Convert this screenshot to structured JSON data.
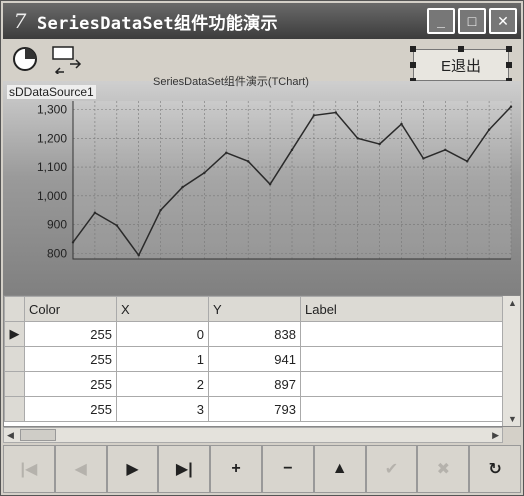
{
  "window": {
    "title": "SeriesDataSet组件功能演示",
    "icon": "seven-glyph"
  },
  "toolbar": {
    "exit_label": "E退出"
  },
  "chart_panel": {
    "datasource_label": "sDDataSource1",
    "title": "SeriesDataSet组件演示(TChart)",
    "axis_labels": [
      "1,300",
      "1,200",
      "1,100",
      "1,000",
      "900",
      "800"
    ]
  },
  "chart_data": {
    "type": "line",
    "title": "SeriesDataSet组件演示(TChart)",
    "xlabel": "",
    "ylabel": "",
    "ylim": [
      780,
      1330
    ],
    "x": [
      0,
      1,
      2,
      3,
      4,
      5,
      6,
      7,
      8,
      9,
      10,
      11,
      12,
      13,
      14,
      15,
      16,
      17,
      18,
      19,
      20
    ],
    "values": [
      838,
      941,
      897,
      793,
      950,
      1030,
      1080,
      1150,
      1120,
      1040,
      1160,
      1280,
      1290,
      1200,
      1180,
      1250,
      1130,
      1160,
      1120,
      1230,
      1310
    ],
    "series": [
      {
        "values": [
          838,
          941,
          897,
          793,
          950,
          1030,
          1080,
          1150,
          1120,
          1040,
          1160,
          1280,
          1290,
          1200,
          1180,
          1250,
          1130,
          1160,
          1120,
          1230,
          1310
        ]
      }
    ],
    "grid": true
  },
  "grid": {
    "columns": [
      "Color",
      "X",
      "Y",
      "Label"
    ],
    "rows": [
      {
        "color": "255",
        "x": "0",
        "y": "838",
        "label": ""
      },
      {
        "color": "255",
        "x": "1",
        "y": "941",
        "label": ""
      },
      {
        "color": "255",
        "x": "2",
        "y": "897",
        "label": ""
      },
      {
        "color": "255",
        "x": "3",
        "y": "793",
        "label": ""
      }
    ]
  },
  "navigator": {
    "buttons": [
      "first",
      "prior",
      "next",
      "last",
      "insert",
      "delete",
      "edit",
      "post",
      "cancel",
      "refresh"
    ],
    "glyphs": [
      "|◀",
      "◀",
      "▶",
      "▶|",
      "+",
      "−",
      "▲",
      "✔",
      "✖",
      "↻"
    ]
  },
  "colors": {
    "titlebar": "#4a4a4a",
    "chart_line": "#2a2a2a"
  }
}
